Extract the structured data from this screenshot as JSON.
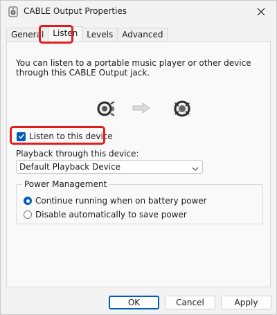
{
  "window": {
    "title": "CABLE Output Properties",
    "app_icon": "speaker-icon",
    "close_icon": "close-icon"
  },
  "tabs": [
    {
      "label": "General",
      "active": false
    },
    {
      "label": "Listen",
      "active": true,
      "highlighted": true
    },
    {
      "label": "Levels",
      "active": false
    },
    {
      "label": "Advanced",
      "active": false
    }
  ],
  "listen": {
    "intro_text": "You can listen to a portable music player or other device through this CABLE Output jack.",
    "images": [
      "source-device-icon",
      "arrow-right-icon",
      "output-device-icon"
    ],
    "listen_checkbox": {
      "label": "Listen to this device",
      "checked": true,
      "highlighted": true
    },
    "playback_label": "Playback through this device:",
    "playback_device": {
      "selected": "Default Playback Device"
    },
    "power_management": {
      "legend": "Power Management",
      "options": [
        {
          "label": "Continue running when on battery power",
          "selected": true
        },
        {
          "label": "Disable automatically to save power",
          "selected": false
        }
      ]
    }
  },
  "buttons": {
    "ok": "OK",
    "cancel": "Cancel",
    "apply": "Apply"
  },
  "colors": {
    "accent": "#005fb8",
    "highlight": "#e31b1b"
  }
}
